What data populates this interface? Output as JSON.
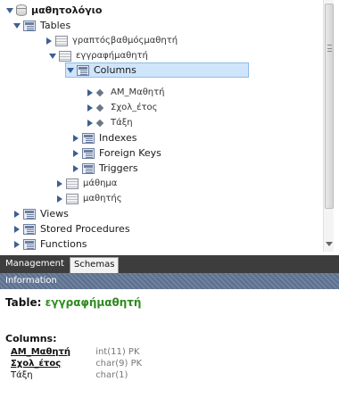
{
  "tree": {
    "schema": "μαθητολόγιο",
    "tables_folder": "Tables",
    "table_grades": "γραπτόςβαθμόςμαθητή",
    "table_enroll": "εγγραφήμαθητή",
    "columns_folder": "Columns",
    "columns": [
      "ΑΜ_Μαθητή",
      "Σχολ_έτος",
      "Τάξη"
    ],
    "indexes": "Indexes",
    "foreign_keys": "Foreign Keys",
    "triggers": "Triggers",
    "table_lesson": "μάθημα",
    "table_student": "μαθητής",
    "views": "Views",
    "stored_procedures": "Stored Procedures",
    "functions": "Functions"
  },
  "tabs": [
    "Management",
    "Schemas"
  ],
  "info": {
    "header": "Information",
    "title_prefix": "Table:",
    "table_name": "εγγραφήμαθητή",
    "columns_heading": "Columns:",
    "columns": [
      {
        "name": "ΑΜ_Μαθητή",
        "type": "int(11) PK"
      },
      {
        "name": "Σχολ_έτος",
        "type": "char(9) PK"
      },
      {
        "name": "Τάξη",
        "type": "char(1)"
      }
    ]
  }
}
